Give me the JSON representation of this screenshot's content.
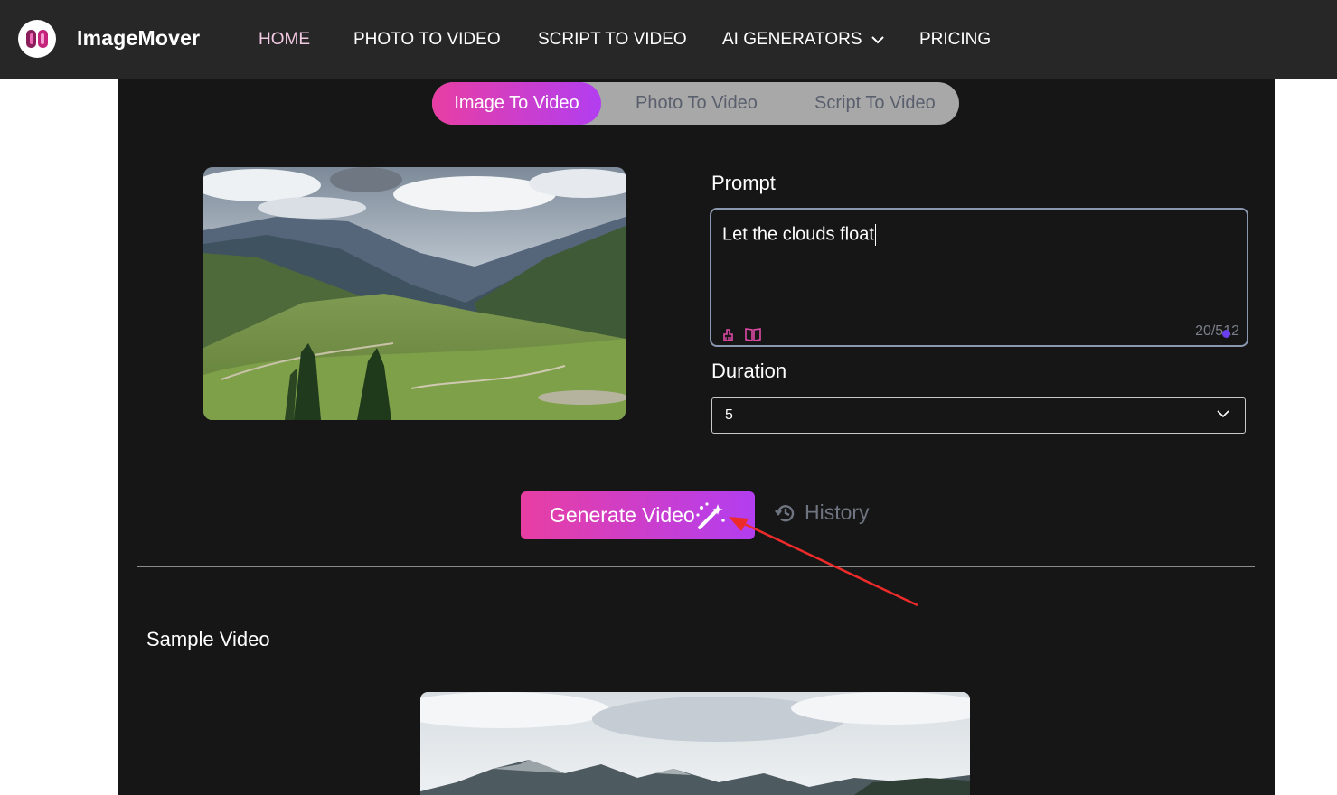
{
  "brand": {
    "name": "ImageMover"
  },
  "nav": {
    "items": [
      {
        "label": "HOME"
      },
      {
        "label": "PHOTO TO VIDEO"
      },
      {
        "label": "SCRIPT TO VIDEO"
      },
      {
        "label": "AI GENERATORS"
      },
      {
        "label": "PRICING"
      }
    ],
    "active": "HOME"
  },
  "tabs": [
    {
      "label": "Image To Video",
      "active": true
    },
    {
      "label": "Photo To Video",
      "active": false
    },
    {
      "label": "Script To Video",
      "active": false
    }
  ],
  "prompt": {
    "label": "Prompt",
    "value": "Let the clouds float",
    "counter": "20/512"
  },
  "duration": {
    "label": "Duration",
    "selected": "5"
  },
  "actions": {
    "generate_label": "Generate Video",
    "history_label": "History"
  },
  "sample": {
    "title": "Sample Video"
  },
  "colors": {
    "accent_start": "#e83ea3",
    "accent_end": "#b23ef0",
    "topbar": "#272727",
    "panel": "#161616",
    "annotation_arrow": "#ee2b2b"
  },
  "icons": [
    "logo-icon",
    "chevron-down-icon",
    "eraser-icon",
    "book-icon",
    "magic-wand-icon",
    "history-icon"
  ]
}
